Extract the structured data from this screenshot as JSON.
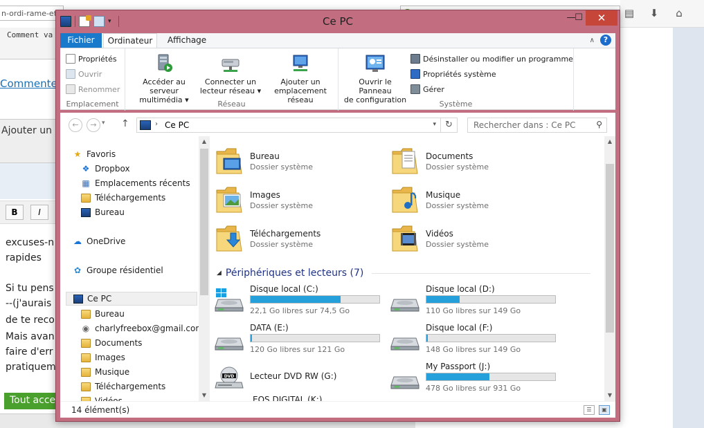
{
  "browser": {
    "url_fragment": "n-ordi-rame-et-",
    "comment_snippet": "Comment va",
    "link_text": "Commenter",
    "add_text": "Ajouter un c",
    "toolbar_bold": "B",
    "toolbar_italic": "I",
    "text_lines": [
      "excuses-n",
      "rapides",
      "",
      "Si tu pens",
      "--(j'aurais",
      "de te reco",
      "Mais avan",
      "faire d'err",
      "pratiquem"
    ],
    "button_label": "Tout acce"
  },
  "window": {
    "title": "Ce PC",
    "minimize": "—",
    "maximize": "☐",
    "close": "✕"
  },
  "ribbon": {
    "tabs": [
      "Fichier",
      "Ordinateur",
      "Affichage"
    ],
    "help": "?",
    "groups": {
      "emplacement": {
        "label": "Emplacement",
        "items": [
          "Propriétés",
          "Ouvrir",
          "Renommer"
        ]
      },
      "reseau": {
        "label": "Réseau",
        "items": [
          {
            "line1": "Accéder au serveur",
            "line2": "multimédia ▾"
          },
          {
            "line1": "Connecter un",
            "line2": "lecteur réseau ▾"
          },
          {
            "line1": "Ajouter un",
            "line2": "emplacement réseau"
          }
        ]
      },
      "systeme": {
        "label": "Système",
        "big": {
          "line1": "Ouvrir le Panneau",
          "line2": "de configuration"
        },
        "items": [
          "Désinstaller ou modifier un programme",
          "Propriétés système",
          "Gérer"
        ]
      }
    }
  },
  "address": {
    "path": "Ce PC",
    "search_placeholder": "Rechercher dans : Ce PC"
  },
  "nav": {
    "items": [
      {
        "label": "Favoris",
        "icon": "star-icon",
        "indent": 0
      },
      {
        "label": "Dropbox",
        "icon": "dropbox-icon",
        "indent": 1
      },
      {
        "label": "Emplacements récents",
        "icon": "recent-places-icon",
        "indent": 1
      },
      {
        "label": "Téléchargements",
        "icon": "downloads-folder-icon",
        "indent": 1
      },
      {
        "label": "Bureau",
        "icon": "desktop-icon",
        "indent": 1
      },
      {
        "label": "OneDrive",
        "icon": "onedrive-icon",
        "indent": 0
      },
      {
        "label": "Groupe résidentiel",
        "icon": "homegroup-icon",
        "indent": 0
      },
      {
        "label": "Ce PC",
        "icon": "computer-icon",
        "indent": 0
      },
      {
        "label": "Bureau",
        "icon": "folder-icon",
        "indent": 1
      },
      {
        "label": "charlyfreebox@gmail.com (j",
        "icon": "user-icon",
        "indent": 1
      },
      {
        "label": "Documents",
        "icon": "folder-icon",
        "indent": 1
      },
      {
        "label": "Images",
        "icon": "folder-icon",
        "indent": 1
      },
      {
        "label": "Musique",
        "icon": "folder-icon",
        "indent": 1
      },
      {
        "label": "Téléchargements",
        "icon": "folder-icon",
        "indent": 1
      },
      {
        "label": "Vidéos",
        "icon": "folder-icon",
        "indent": 1
      }
    ]
  },
  "folders": [
    {
      "name": "Bureau",
      "sub": "Dossier système",
      "icon": "desktop-folder-icon"
    },
    {
      "name": "Documents",
      "sub": "Dossier système",
      "icon": "documents-folder-icon"
    },
    {
      "name": "Images",
      "sub": "Dossier système",
      "icon": "pictures-folder-icon"
    },
    {
      "name": "Musique",
      "sub": "Dossier système",
      "icon": "music-folder-icon"
    },
    {
      "name": "Téléchargements",
      "sub": "Dossier système",
      "icon": "downloads-folder-icon"
    },
    {
      "name": "Vidéos",
      "sub": "Dossier système",
      "icon": "videos-folder-icon"
    }
  ],
  "devices_header": "Périphériques et lecteurs (7)",
  "drives": [
    {
      "name": "Disque local (C:)",
      "free": "22,1 Go libres sur 74,5 Go",
      "used_pct": 70,
      "icon": "windows-drive-icon"
    },
    {
      "name": "Disque local (D:)",
      "free": "110 Go libres sur 149 Go",
      "used_pct": 26,
      "icon": "hard-drive-icon"
    },
    {
      "name": "DATA (E:)",
      "free": "120 Go libres sur 121 Go",
      "used_pct": 1,
      "icon": "hard-drive-icon"
    },
    {
      "name": "Disque local (F:)",
      "free": "148 Go libres sur 149 Go",
      "used_pct": 1,
      "icon": "hard-drive-icon"
    },
    {
      "name": "Lecteur DVD RW (G:)",
      "free": "",
      "used_pct": null,
      "icon": "dvd-drive-icon"
    },
    {
      "name": "My Passport (J:)",
      "free": "478 Go libres sur 931 Go",
      "used_pct": 49,
      "icon": "hard-drive-icon"
    }
  ],
  "partial_item": "EOS DIGITAL (K:)",
  "status": {
    "count": "14 élément(s)"
  },
  "colors": {
    "frame": "#c26e80",
    "accent": "#1979ca",
    "bar_fill": "#26a0da",
    "close": "#c7463a"
  }
}
